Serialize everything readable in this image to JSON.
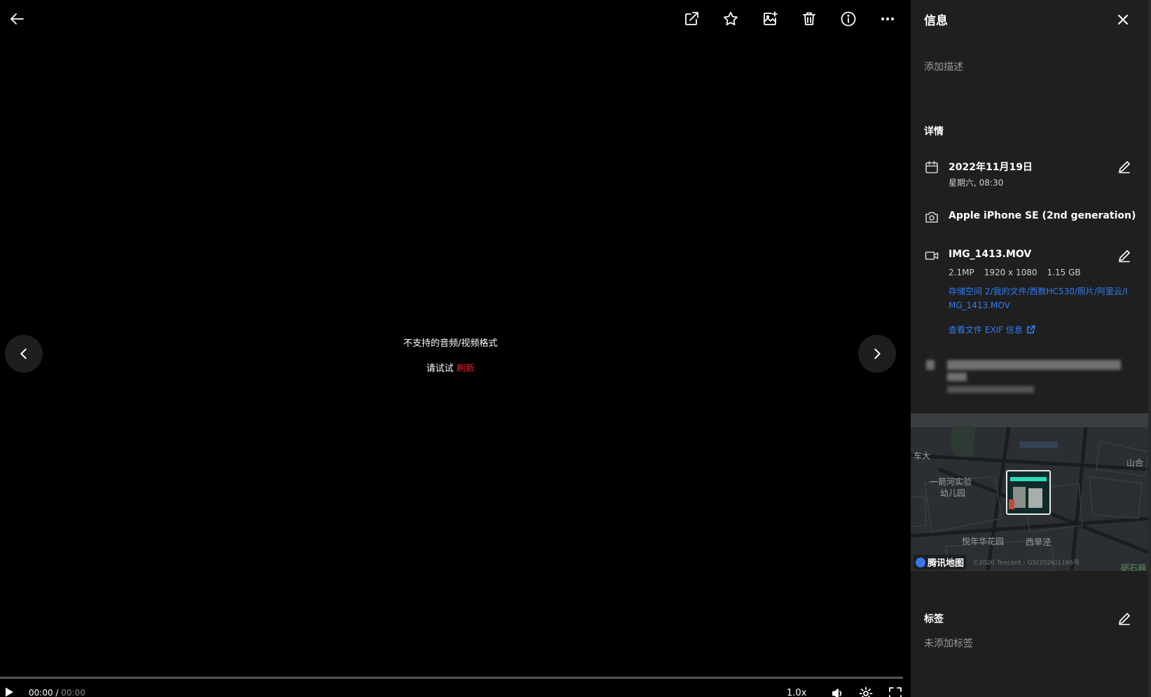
{
  "toolbar": {
    "back_icon": "arrow-left-icon",
    "items": [
      {
        "name": "share",
        "icon": "open-external-icon"
      },
      {
        "name": "favorite",
        "icon": "star-icon"
      },
      {
        "name": "add-to-album",
        "icon": "image-plus-icon"
      },
      {
        "name": "delete",
        "icon": "trash-icon"
      },
      {
        "name": "info",
        "icon": "info-icon"
      },
      {
        "name": "more",
        "icon": "more-horizontal-icon"
      }
    ]
  },
  "viewer": {
    "error_message": "不支持的音频/视频格式",
    "retry_prefix": "请试试",
    "retry_link": "刷新",
    "retry_link_color": "#e8212d"
  },
  "player": {
    "current_time": "00:00",
    "separator": " / ",
    "duration": "00:00",
    "progress": 0,
    "speed": "1.0x"
  },
  "sidebar": {
    "title": "信息",
    "description_placeholder": "添加描述",
    "details_heading": "详情",
    "date": {
      "main": "2022年11月19日",
      "sub": "星期六, 08:30"
    },
    "camera": {
      "model": "Apple iPhone SE (2nd generation)"
    },
    "file": {
      "name": "IMG_1413.MOV",
      "megapixels": "2.1MP",
      "resolution": "1920 x 1080",
      "size": "1.15 GB",
      "path": "存储空间 2/我的文件/西数HC530/照片/阿里云/IMG_1413.MOV",
      "exif_link": "查看文件 EXIF 信息"
    },
    "map": {
      "labels": [
        "车大",
        "山合",
        "一箭河实验",
        "幼儿园",
        "悦年华花园",
        "西旱泾",
        "砺石麻"
      ],
      "provider": "腾讯地图",
      "copyright": "©2026 Tencent - GS(2026)1166号"
    },
    "tags_heading": "标签",
    "tags_empty": "未添加标签",
    "link_color": "#2f7cf6"
  }
}
